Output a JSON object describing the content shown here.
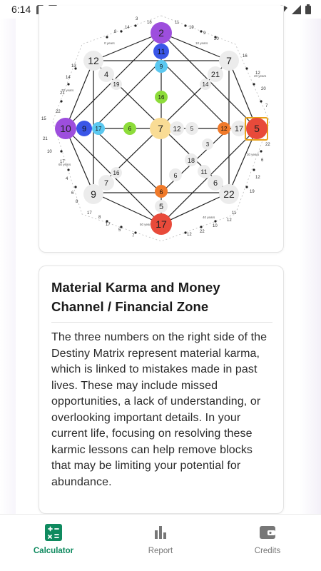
{
  "status_bar": {
    "time": "6:14",
    "icons": [
      "sd-card-icon",
      "text-icon",
      "wifi-icon",
      "signal-icon",
      "battery-icon"
    ]
  },
  "matrix": {
    "top": "2",
    "top_inner": "11",
    "top_inner2": "9",
    "upper_mid": "16",
    "left": "10",
    "left_inner": "9",
    "left_inner2": "17",
    "left_mid": "6",
    "center": "7",
    "center_right1": "12",
    "center_right2": "5",
    "right_inner2": "12",
    "right_inner": "17",
    "right": "5",
    "bottom_mid": "6",
    "bottom_inner": "5",
    "bottom": "17",
    "tl": "12",
    "tl_inner": "4",
    "tl_inner2": "19",
    "tr": "7",
    "tr_inner": "21",
    "tr_inner2": "14",
    "bl": "9",
    "bl_inner": "7",
    "bl_inner2": "16",
    "br": "22",
    "br_inner": "6",
    "br_inner2": "11",
    "love_3": "3",
    "love_18": "18",
    "love_6": "6",
    "love_11": "11",
    "outer_small": [
      "18",
      "3",
      "14",
      "8",
      "11",
      "19",
      "9",
      "20",
      "12",
      "20",
      "7",
      "22",
      "6",
      "12",
      "19",
      "10",
      "22",
      "12",
      "7",
      "5",
      "17",
      "6",
      "4",
      "17",
      "22",
      "21",
      "14",
      "13",
      "18",
      "12",
      "6",
      "4",
      "9",
      "19",
      "10",
      "11",
      "8",
      "17",
      "8",
      "7",
      "14",
      "6",
      "21",
      "15",
      "22",
      "11",
      "12",
      "17",
      "7",
      "10",
      "9",
      "9",
      "8",
      "16",
      "11",
      "12"
    ],
    "age_labels": [
      "10 years",
      "20 years",
      "30 years",
      "40 years",
      "50 years",
      "60 years",
      "70 years",
      "0 years"
    ]
  },
  "info_card": {
    "title": "Material Karma and Money Channel / Financial Zone",
    "body": "The three numbers on the right side of the Destiny Matrix represent material karma, which is linked to mistakes made in past lives. These may include missed opportunities, a lack of understanding, or overlooking important details. In your current life, focusing on resolving these karmic lessons can help remove blocks that may be limiting your potential for abundance."
  },
  "nav": {
    "calculator": "Calculator",
    "report": "Report",
    "credits": "Credits"
  },
  "colors": {
    "purple": "#9d4edd",
    "blue": "#3a56e8",
    "cyan": "#5bc8f0",
    "green": "#8ddc3a",
    "yellow": "#f9dc95",
    "orange": "#f07a2a",
    "red": "#e84a3a",
    "grey": "#ececec",
    "accent": "#0f8a5f"
  }
}
